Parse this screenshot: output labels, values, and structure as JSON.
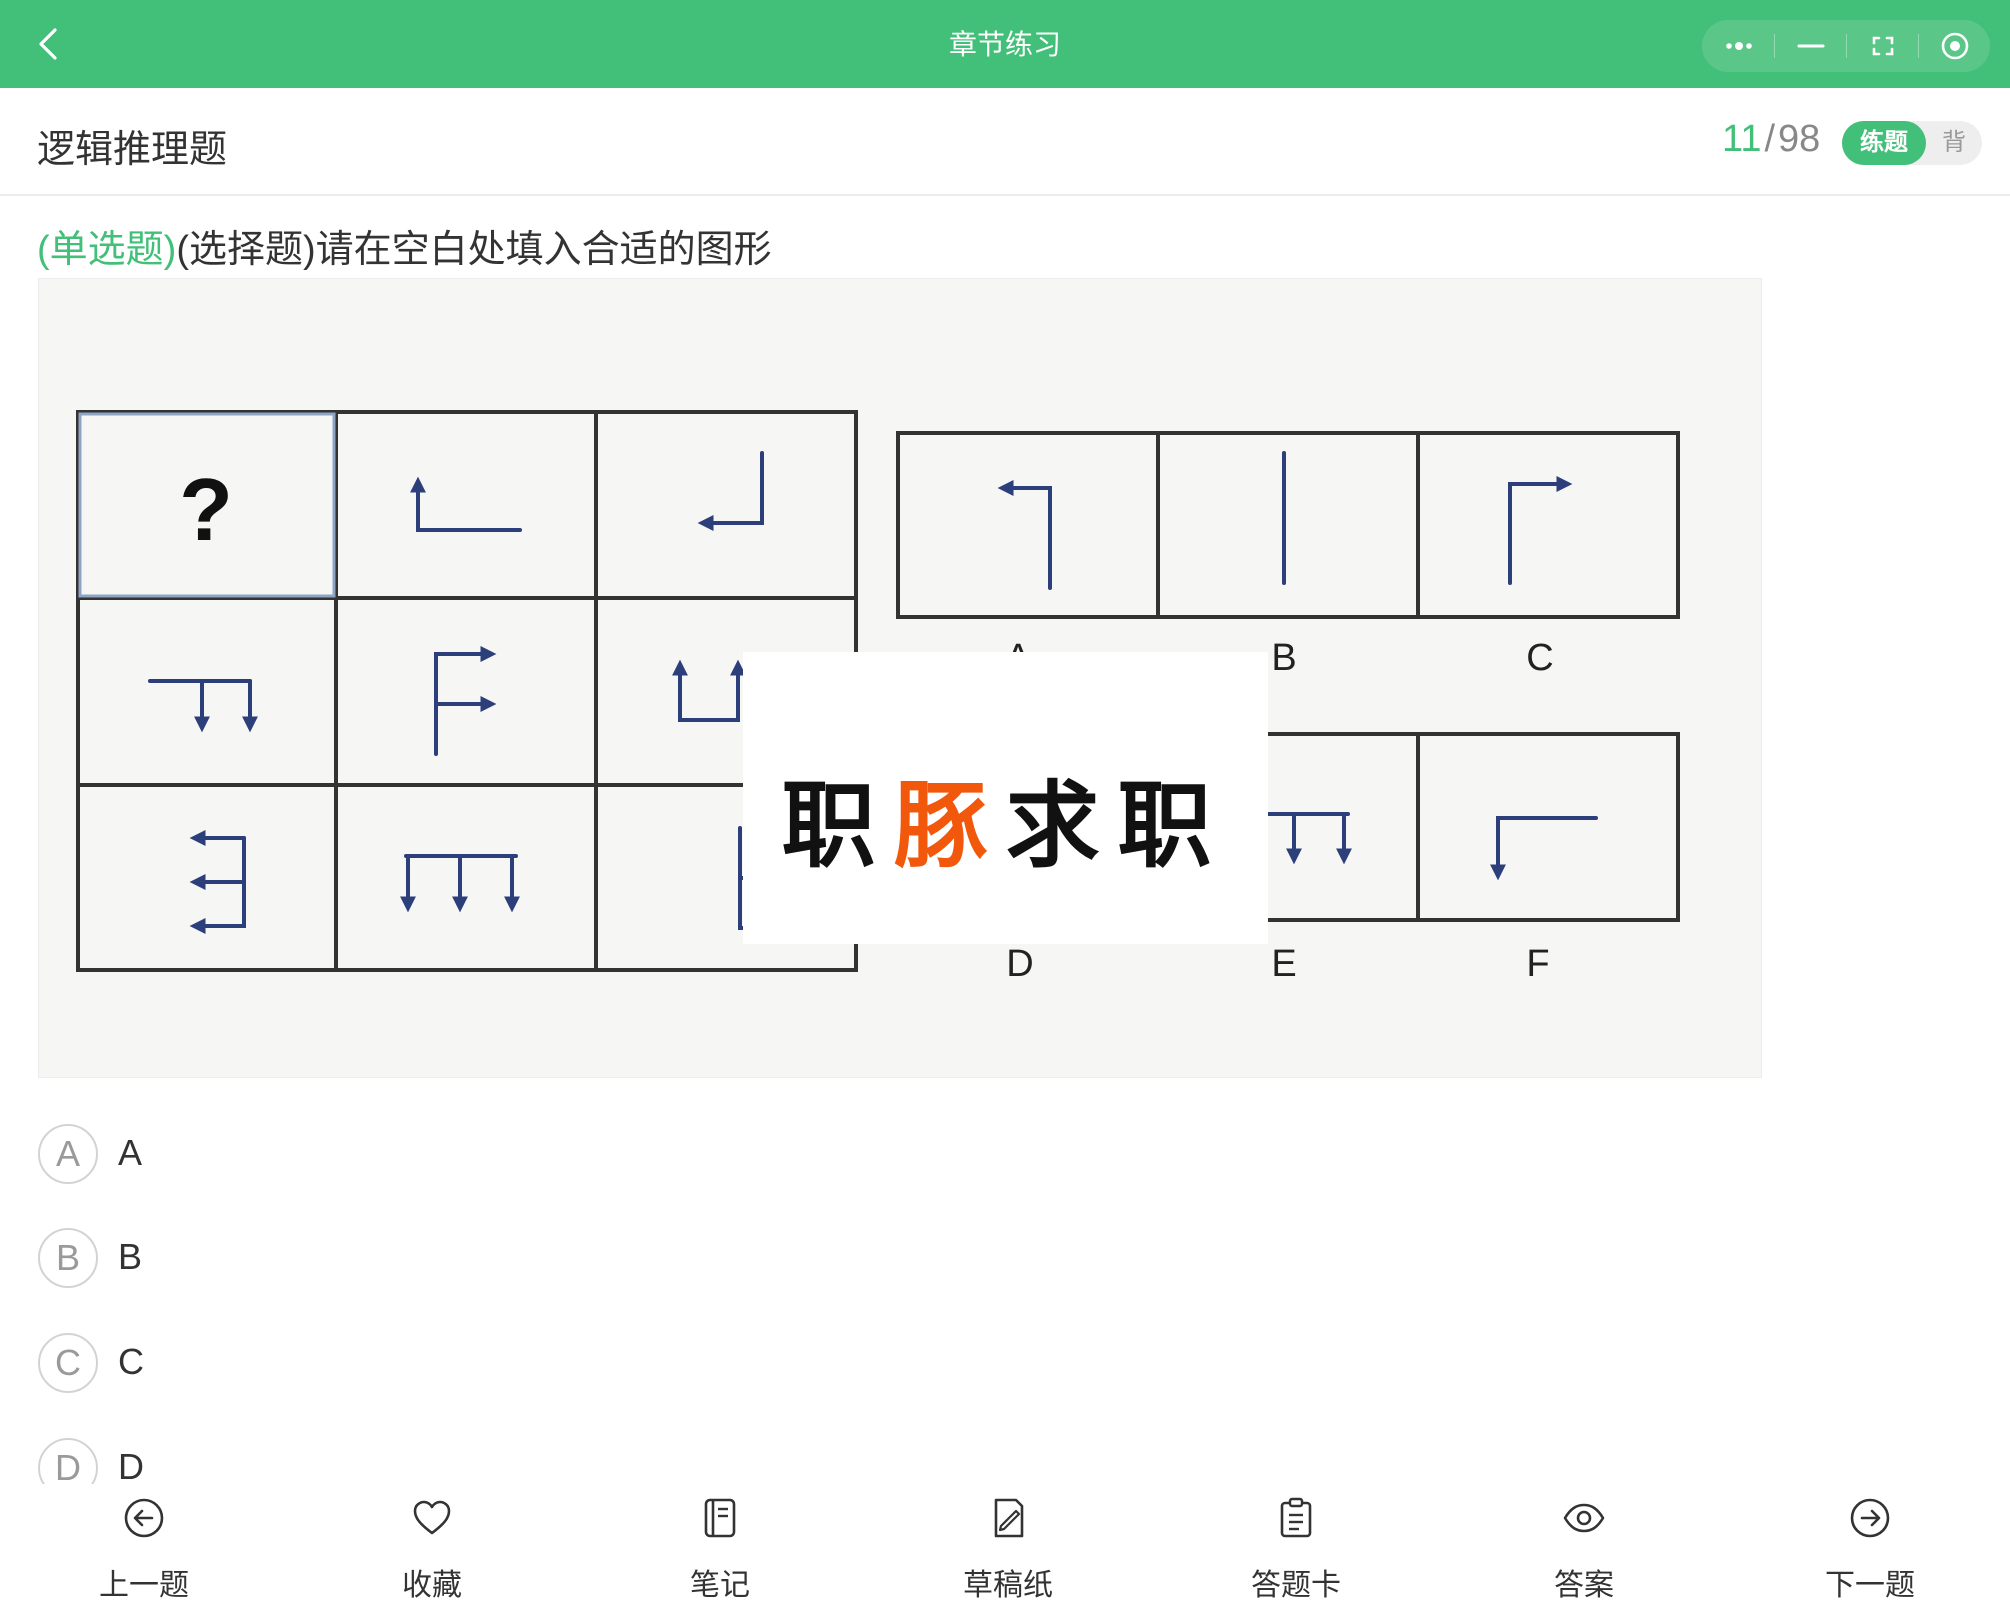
{
  "topbar": {
    "title": "章节练习",
    "back_icon": "chevron-left-icon",
    "capsule_icons": [
      "more-dots-icon",
      "minimize-icon",
      "restore-icon",
      "close-circle-icon"
    ]
  },
  "subject": {
    "title": "逻辑推理题",
    "progress_current": "11",
    "progress_separator": "/",
    "progress_total": "98",
    "mode_active": "练题",
    "mode_other": "背"
  },
  "question": {
    "type_label": "(单选题)",
    "text": "(选择题)请在空白处填入合适的图形",
    "figure": {
      "grid_question_mark": "?",
      "option_labels": [
        "A",
        "B",
        "C",
        "D",
        "E",
        "F"
      ]
    }
  },
  "watermark": {
    "part1": "职",
    "part2": "豚",
    "part3": "求职"
  },
  "options": [
    {
      "letter": "A",
      "label": "A"
    },
    {
      "letter": "B",
      "label": "B"
    },
    {
      "letter": "C",
      "label": "C"
    },
    {
      "letter": "D",
      "label": "D"
    }
  ],
  "bottombar": {
    "prev": "上一题",
    "favorite": "收藏",
    "notes": "笔记",
    "scratch": "草稿纸",
    "answer_card": "答题卡",
    "answer": "答案",
    "next": "下一题"
  },
  "colors": {
    "accent": "#42bf78",
    "watermark_orange": "#f2580c",
    "figure_ink": "#2c3f7a"
  }
}
